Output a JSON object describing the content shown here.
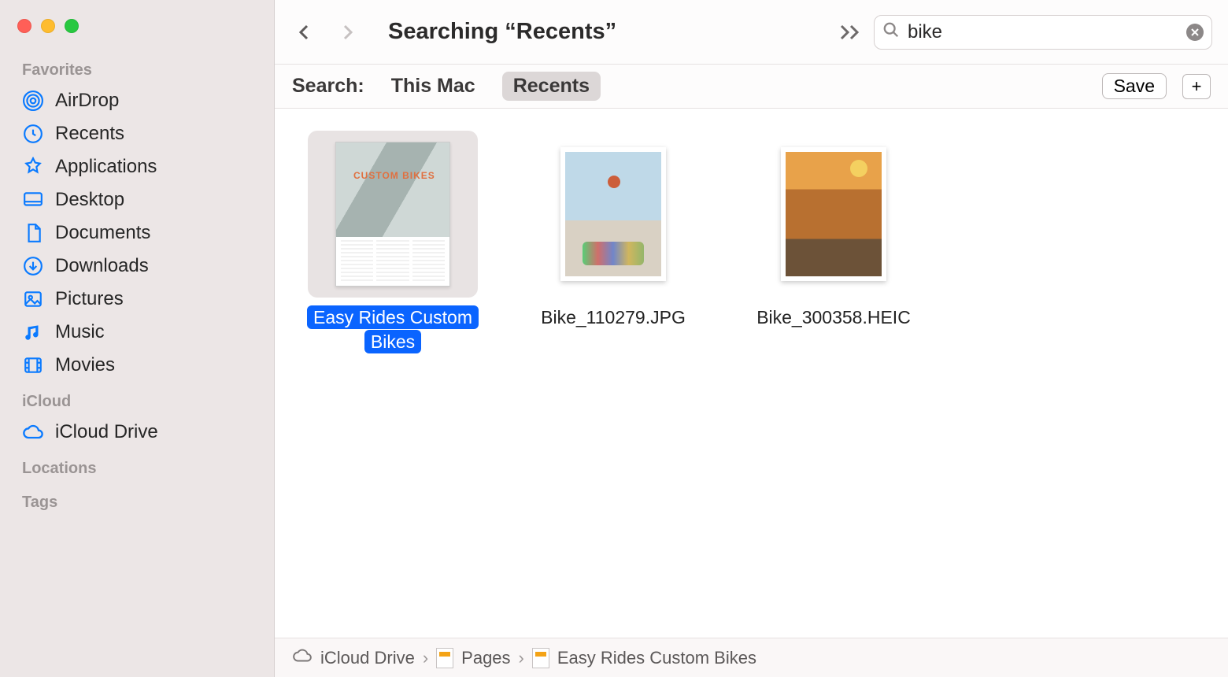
{
  "sidebar": {
    "sections": {
      "favorites": {
        "title": "Favorites",
        "items": [
          {
            "label": "AirDrop"
          },
          {
            "label": "Recents"
          },
          {
            "label": "Applications"
          },
          {
            "label": "Desktop"
          },
          {
            "label": "Documents"
          },
          {
            "label": "Downloads"
          },
          {
            "label": "Pictures"
          },
          {
            "label": "Music"
          },
          {
            "label": "Movies"
          }
        ]
      },
      "icloud": {
        "title": "iCloud",
        "items": [
          {
            "label": "iCloud Drive"
          }
        ]
      },
      "locations": {
        "title": "Locations"
      },
      "tags": {
        "title": "Tags"
      }
    }
  },
  "toolbar": {
    "title": "Searching “Recents”",
    "search_value": "bike"
  },
  "scopebar": {
    "label": "Search:",
    "this_mac": "This Mac",
    "recents": "Recents",
    "save": "Save"
  },
  "files": [
    {
      "name": "Easy Rides Custom Bikes",
      "selected": true,
      "kind": "pages"
    },
    {
      "name": "Bike_110279.JPG",
      "selected": false,
      "kind": "photo1"
    },
    {
      "name": "Bike_300358.HEIC",
      "selected": false,
      "kind": "photo2"
    }
  ],
  "thumb_text": "CUSTOM BIKES",
  "pathbar": {
    "seg0": "iCloud Drive",
    "seg1": "Pages",
    "seg2": "Easy Rides Custom Bikes"
  }
}
